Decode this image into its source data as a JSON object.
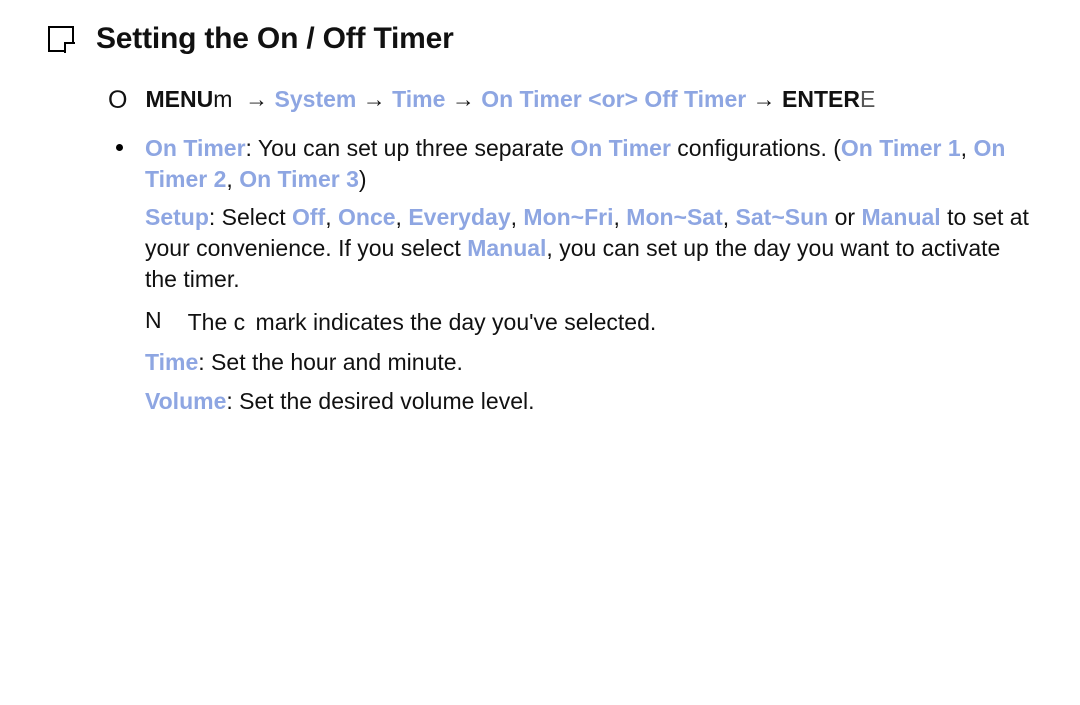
{
  "title": "Setting the On / Off Timer",
  "path": {
    "prefix_o": "O",
    "menu": "MENU",
    "menu_suffix": "m",
    "arrow": "→",
    "system": "System",
    "time": "Time",
    "on_timer_or_off": "On Timer <or> Off Timer",
    "enter": "ENTER",
    "enter_suffix": "E"
  },
  "bullet": {
    "on_timer_label": "On Timer",
    "on_timer_desc1": ": You can set up three separate ",
    "on_timer_hl": "On Timer",
    "on_timer_desc2": " configurations. (",
    "ot1": "On Timer 1",
    "sep": ", ",
    "ot2": "On Timer 2",
    "ot3": "On Timer 3",
    "close": ")"
  },
  "setup": {
    "label": "Setup",
    "after_label": ": Select ",
    "opt_off": "Off",
    "opt_once": "Once",
    "opt_everyday": "Everyday",
    "opt_monfri": "Mon~Fri",
    "opt_monsat": "Mon~Sat",
    "opt_satsun": "Sat~Sun",
    "or": " or ",
    "manual": "Manual",
    "after_manual": " to set at your convenience. If you select ",
    "manual2": "Manual",
    "tail": ", you can set up the day you want to activate the timer."
  },
  "note": {
    "n_prefix": "N",
    "pre": "The ",
    "c_mark": "c",
    "post": " mark indicates the day you've selected."
  },
  "time_line": {
    "label": "Time",
    "text": ": Set the hour and minute."
  },
  "volume_line": {
    "label": "Volume",
    "text": ": Set the desired volume level."
  }
}
